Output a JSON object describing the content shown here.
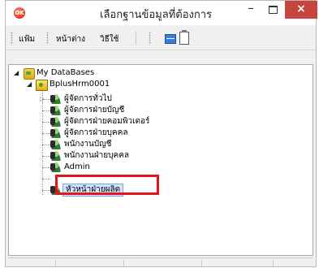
{
  "window": {
    "title": "เลือกฐานข้อมูลที่ต้องการ",
    "app_icon": "OK",
    "close_glyph": "×",
    "minimize_glyph": "–"
  },
  "toolbar": {
    "items": [
      "แฟ้ม",
      "หน้าต่าง",
      "วิธีใช้"
    ]
  },
  "tree": {
    "root_label": "My DataBases",
    "database_label": "BplusHrm0001",
    "users": [
      "ผู้จัดการทั่วไป",
      "ผู้จัดการฝ่ายบัญชี",
      "ผู้จัดการฝ่ายคอมพิวเตอร์",
      "ผู้จัดการฝ่ายบุคคล",
      "พนักงานบัญชี",
      "พนักงานฝ่ายบุคคล",
      "Admin",
      "หัวหน้าฝ่ายผลิต"
    ],
    "selected_user": "หัวหน้าฝ่ายผลิต"
  },
  "colors": {
    "close_button": "#c7443c",
    "highlight_box": "#e5141a",
    "selection": "#cfe5ff"
  }
}
